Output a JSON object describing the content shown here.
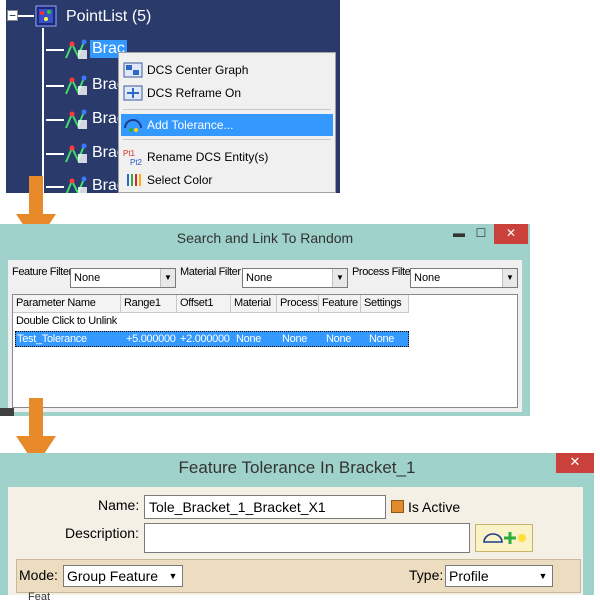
{
  "tree": {
    "root_label": "PointList (5)",
    "items": [
      {
        "label": "Brac",
        "selected": true
      },
      {
        "label": "Brac"
      },
      {
        "label": "Brac"
      },
      {
        "label": "Brac"
      },
      {
        "label": "Brac"
      }
    ]
  },
  "context_menu": {
    "items": [
      {
        "label": "DCS Center Graph",
        "icon": "center-graph-icon"
      },
      {
        "label": "DCS Reframe On",
        "icon": "reframe-icon"
      },
      {
        "label": "Add Tolerance...",
        "icon": "add-tolerance-icon",
        "highlighted": true
      },
      {
        "label": "Rename DCS Entity(s)",
        "icon": "rename-entity-icon"
      },
      {
        "label": "Select Color",
        "icon": "color-bars-icon"
      }
    ]
  },
  "search_dialog": {
    "title": "Search and Link To Random",
    "minimize": "▬",
    "maximize": "☐",
    "close": "✕",
    "feature_filter_label": "Feature Filter",
    "feature_filter_value": "None",
    "material_filter_label": "Material Filter",
    "material_filter_value": "None",
    "process_filter_label": "Process Filter",
    "process_filter_value": "None",
    "columns": [
      "Parameter Name",
      "Range1",
      "Offset1",
      "Material",
      "Process",
      "Feature",
      "Settings"
    ],
    "unlink_text": "Double Click to Unlink",
    "row": [
      "Test_Tolerance",
      "+5.000000",
      "+2.000000",
      "None",
      "None",
      "None",
      "None"
    ]
  },
  "feature_dialog": {
    "title": "Feature Tolerance In Bracket_1",
    "close": "✕",
    "name_label": "Name:",
    "name_value": "Tole_Bracket_1_Bracket_X1",
    "is_active_label": "Is Active",
    "description_label": "Description:",
    "description_value": "",
    "mode_label": "Mode:",
    "mode_value": "Group Feature",
    "type_label": "Type:",
    "type_value": "Profile",
    "cut_text": "Feat"
  },
  "colors": {
    "tree_bg": "#2a3a6a",
    "selection": "#3399ff",
    "dialog_frame": "#9fd2ca",
    "close_button": "#c9413a",
    "arrow": "#e88a2a"
  }
}
